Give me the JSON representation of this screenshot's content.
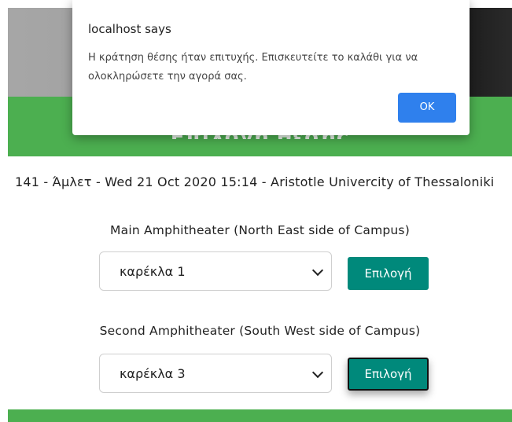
{
  "dialog": {
    "title": "localhost says",
    "message": "Η κράτηση θέσης ήταν επιτυχής. Επισκευτείτε το καλάθι για να ολοκληρώσετε την αγορά σας.",
    "ok_label": "OK",
    "ok_color": "#2f80ed"
  },
  "page": {
    "banner_title": "Επιλογή θέσης",
    "event_line": "141 - Άμλετ - Wed 21 Oct 2020 15:14 - Aristotle Univercity of Thessaloniki",
    "accent_color": "#4caf50",
    "button_color": "#00897b"
  },
  "venues": [
    {
      "name": "Main Amphitheater (North East side of Campus)",
      "selected_seat": "καρέκλα 1",
      "button_label": "Επιλογή"
    },
    {
      "name": "Second Amphitheater (South West side of Campus)",
      "selected_seat": "καρέκλα 3",
      "button_label": "Επιλογή"
    }
  ]
}
